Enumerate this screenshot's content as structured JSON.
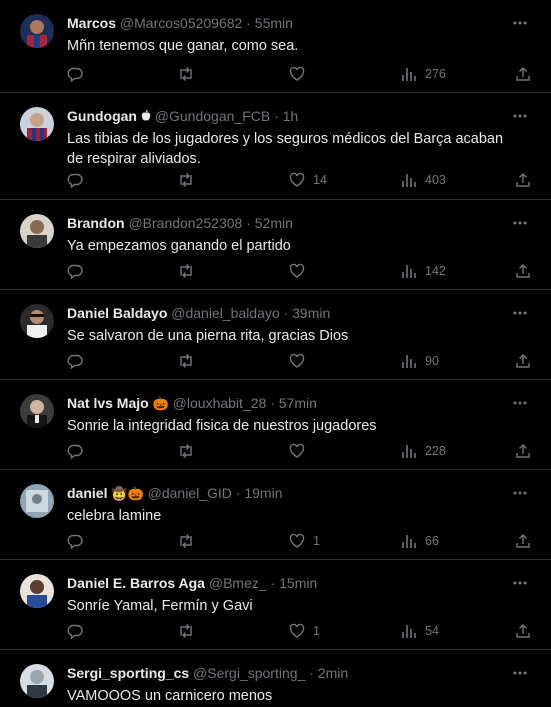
{
  "colors": {
    "background": "#000000",
    "text": "#e7e9ea",
    "muted": "#71767b",
    "divider": "#2f3336"
  },
  "icons": [
    "reply-icon",
    "retweet-icon",
    "like-icon",
    "views-icon",
    "share-icon",
    "more-icon"
  ],
  "tweets": [
    {
      "name": "Marcos",
      "badge": "",
      "handle": "@Marcos05209682",
      "time": "55min",
      "text": "Mñn tenemos que ganar, como sea.",
      "likes": "",
      "views": "276"
    },
    {
      "name": "Gundogan",
      "badge": "",
      "handle": "@Gundogan_FCB",
      "time": "1h",
      "text": "Las tibias de los jugadores y los seguros médicos del Barça acaban de respirar aliviados.",
      "likes": "14",
      "views": "403"
    },
    {
      "name": "Brandon",
      "badge": "",
      "handle": "@Brandon252308",
      "time": "52min",
      "text": "Ya empezamos ganando el partido",
      "likes": "",
      "views": "142"
    },
    {
      "name": "Daniel Baldayo",
      "badge": "",
      "handle": "@daniel_baldayo",
      "time": "39min",
      "text": "Se salvaron de una pierna rita, gracias Dios",
      "likes": "",
      "views": "90"
    },
    {
      "name": "Nat lvs Majo",
      "badge": "🎃",
      "handle": "@louxhabit_28",
      "time": "57min",
      "text": "Sonrie la integridad fisica de nuestros jugadores",
      "likes": "",
      "views": "228"
    },
    {
      "name": "daniel",
      "badge": "🤠🎃",
      "handle": "@daniel_GID",
      "time": "19min",
      "text": "celebra lamine",
      "likes": "1",
      "views": "66"
    },
    {
      "name": "Daniel E. Barros Aga",
      "badge": "",
      "handle": "@Bmez_",
      "time": "15min",
      "text": "Sonríe Yamal, Fermín y Gavi",
      "likes": "1",
      "views": "54"
    },
    {
      "name": "Sergi_sporting_cs",
      "badge": "",
      "handle": "@Sergi_sporting_",
      "time": "2min",
      "text": "VAMOOOS un carnicero menos",
      "likes": "",
      "views": ""
    }
  ]
}
